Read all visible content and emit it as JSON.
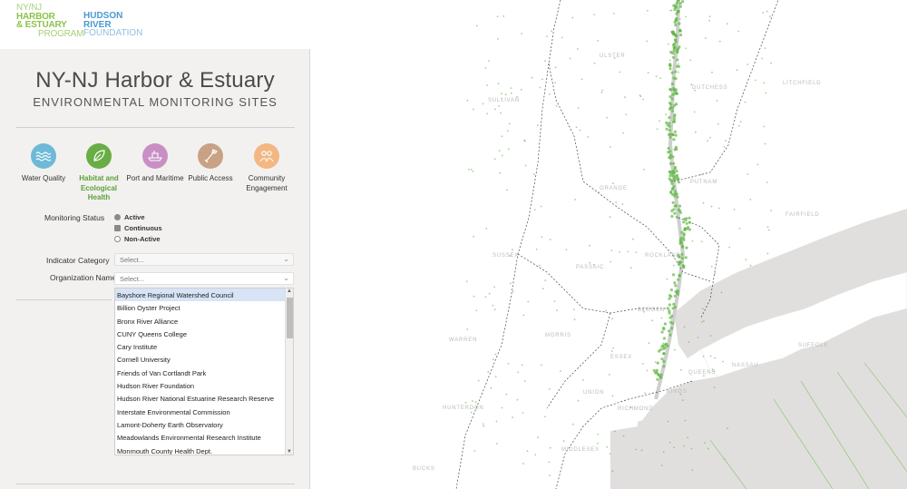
{
  "logos": {
    "heep": {
      "line1": "NY/NJ",
      "line2": "HARBOR",
      "line3": "& ESTUARY",
      "line4": "PROGRAM"
    },
    "hrf": {
      "line1": "HUDSON",
      "line2": "RIVER",
      "line3": "FOUNDATION"
    }
  },
  "header": {
    "title": "NY-NJ Harbor & Estuary",
    "subtitle": "ENVIRONMENTAL MONITORING SITES"
  },
  "themes": [
    {
      "label": "Water Quality",
      "icon": "water-wave-icon",
      "color": "#6fb9d8",
      "active": false
    },
    {
      "label": "Habitat and Ecological Health",
      "icon": "leaf-icon",
      "color": "#69ad45",
      "active": true
    },
    {
      "label": "Port and Maritime",
      "icon": "ship-icon",
      "color": "#c98fc4",
      "active": false
    },
    {
      "label": "Public Access",
      "icon": "paddle-icon",
      "color": "#c9a184",
      "active": false
    },
    {
      "label": "Community Engagement",
      "icon": "people-icon",
      "color": "#f2b782",
      "active": false
    }
  ],
  "monitoring_status": {
    "label": "Monitoring Status",
    "options": [
      {
        "label": "Active",
        "color": "#8a8a8a"
      },
      {
        "label": "Continuous",
        "color": "#8a8a8a"
      },
      {
        "label": "Non-Active",
        "color": "#ffffff"
      }
    ]
  },
  "indicator_category": {
    "label": "Indicator Category",
    "help": "?",
    "placeholder": "Select..."
  },
  "organization_name": {
    "label": "Organization Name",
    "placeholder": "Select...",
    "options": [
      "Bayshore Regional Watershed Council",
      "Billion Oyster Project",
      "Bronx River Alliance",
      "CUNY Queens College",
      "Cary Institute",
      "Cornell University",
      "Friends of Van Cortlandt Park",
      "Hudson River Foundation",
      "Hudson River National Estuarine Research Reserve",
      "Interstate Environmental Commission",
      "Lamont-Doherty Earth Observatory",
      "Meadowlands Environmental Research Institute",
      "Monmouth County Health Dept."
    ],
    "selected_index": 0
  },
  "map": {
    "places": [
      "ULSTER",
      "DUTCHESS",
      "LITCHFIELD",
      "SULLIVAN",
      "ORANGE",
      "PUTNAM",
      "FAIRFIELD",
      "SUSSEX",
      "PASSAIC",
      "ROCKLAND",
      "BERGEN",
      "WARREN",
      "MORRIS",
      "ESSEX",
      "HUNTERDON",
      "UNION",
      "RICHMOND",
      "QUEENS",
      "NASSAU",
      "SUFFOLK",
      "KINGS",
      "MIDDLESEX",
      "BUCKS"
    ],
    "site_color": "#5fb843",
    "water_color": "#e1dfdd"
  }
}
